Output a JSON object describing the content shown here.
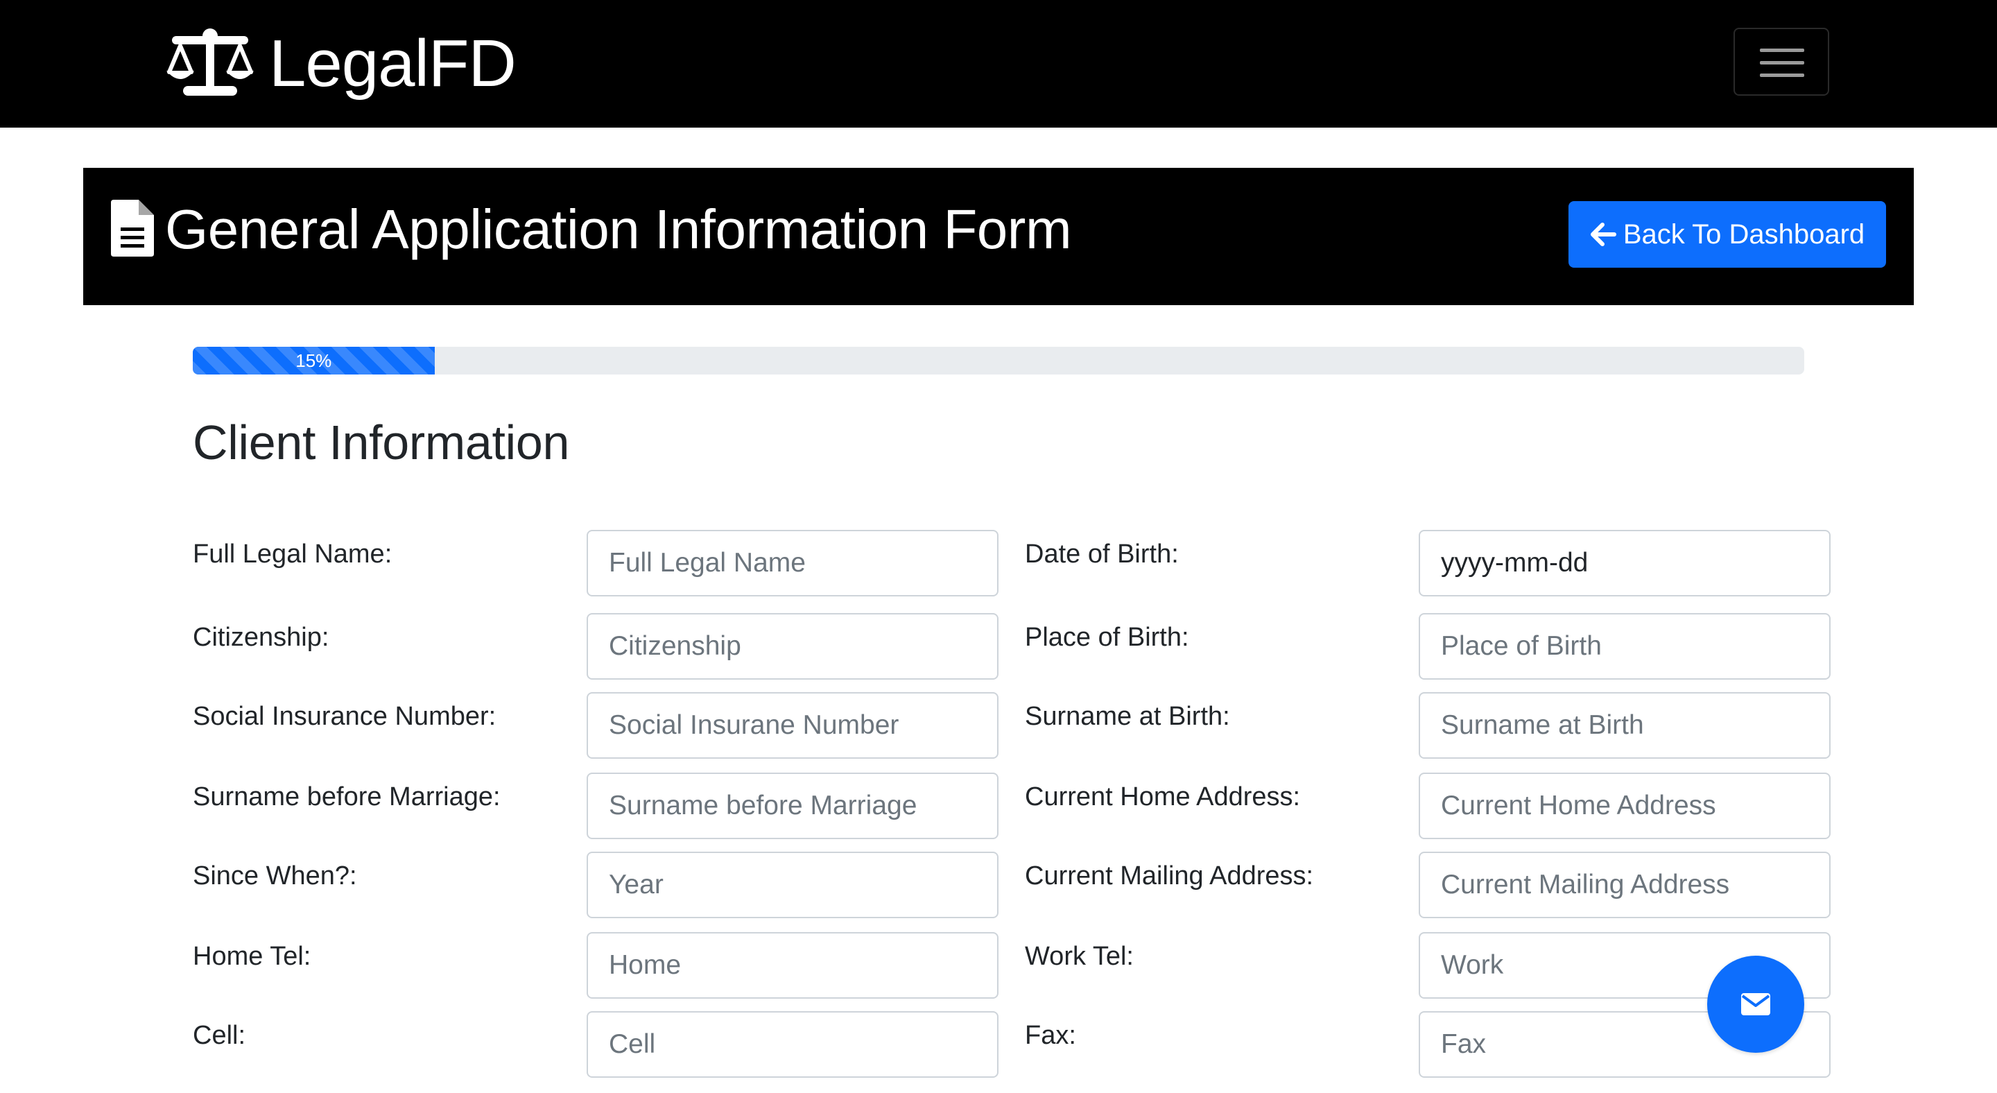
{
  "navbar": {
    "brand_name": "LegalFD",
    "brand_icon": "balance-scale-icon",
    "menu_icon": "hamburger-menu-icon"
  },
  "header": {
    "icon": "document-icon",
    "title": "General Application Information Form",
    "back_button_label": "Back To Dashboard",
    "back_button_icon": "arrow-left-icon"
  },
  "progress": {
    "percent": 15,
    "label": "15%"
  },
  "section": {
    "title": "Client Information"
  },
  "form": {
    "rows": [
      {
        "left": {
          "label": "Full Legal Name:",
          "placeholder": "Full Legal Name",
          "value": ""
        },
        "right": {
          "label": "Date of Birth:",
          "display": "yyyy-mm-dd"
        }
      },
      {
        "left": {
          "label": "Citizenship:",
          "placeholder": "Citizenship",
          "value": ""
        },
        "right": {
          "label": "Place of Birth:",
          "placeholder": "Place of Birth",
          "value": ""
        }
      },
      {
        "left": {
          "label": "Social Insurance Number:",
          "placeholder": "Social Insurane Number",
          "value": ""
        },
        "right": {
          "label": "Surname at Birth:",
          "placeholder": "Surname at Birth",
          "value": ""
        }
      },
      {
        "left": {
          "label": "Surname before Marriage:",
          "placeholder": "Surname before Marriage",
          "value": ""
        },
        "right": {
          "label": "Current Home Address:",
          "placeholder": "Current Home Address",
          "value": ""
        }
      },
      {
        "left": {
          "label": "Since When?:",
          "placeholder": "Year",
          "value": ""
        },
        "right": {
          "label": "Current Mailing Address:",
          "placeholder": "Current Mailing Address",
          "value": ""
        }
      },
      {
        "left": {
          "label": "Home Tel:",
          "placeholder": "Home",
          "value": ""
        },
        "right": {
          "label": "Work Tel:",
          "placeholder": "Work",
          "value": ""
        }
      },
      {
        "left": {
          "label": "Cell:",
          "placeholder": "Cell",
          "value": ""
        },
        "right": {
          "label": "Fax:",
          "placeholder": "Fax",
          "value": ""
        }
      }
    ]
  },
  "fab": {
    "icon": "envelope-icon"
  },
  "colors": {
    "primary": "#0d6efd",
    "navbar_bg": "#000000",
    "header_bg": "#000000",
    "progress_track": "#e9ecef",
    "input_border": "#ced4da",
    "placeholder": "#6c757d",
    "text": "#212529"
  }
}
